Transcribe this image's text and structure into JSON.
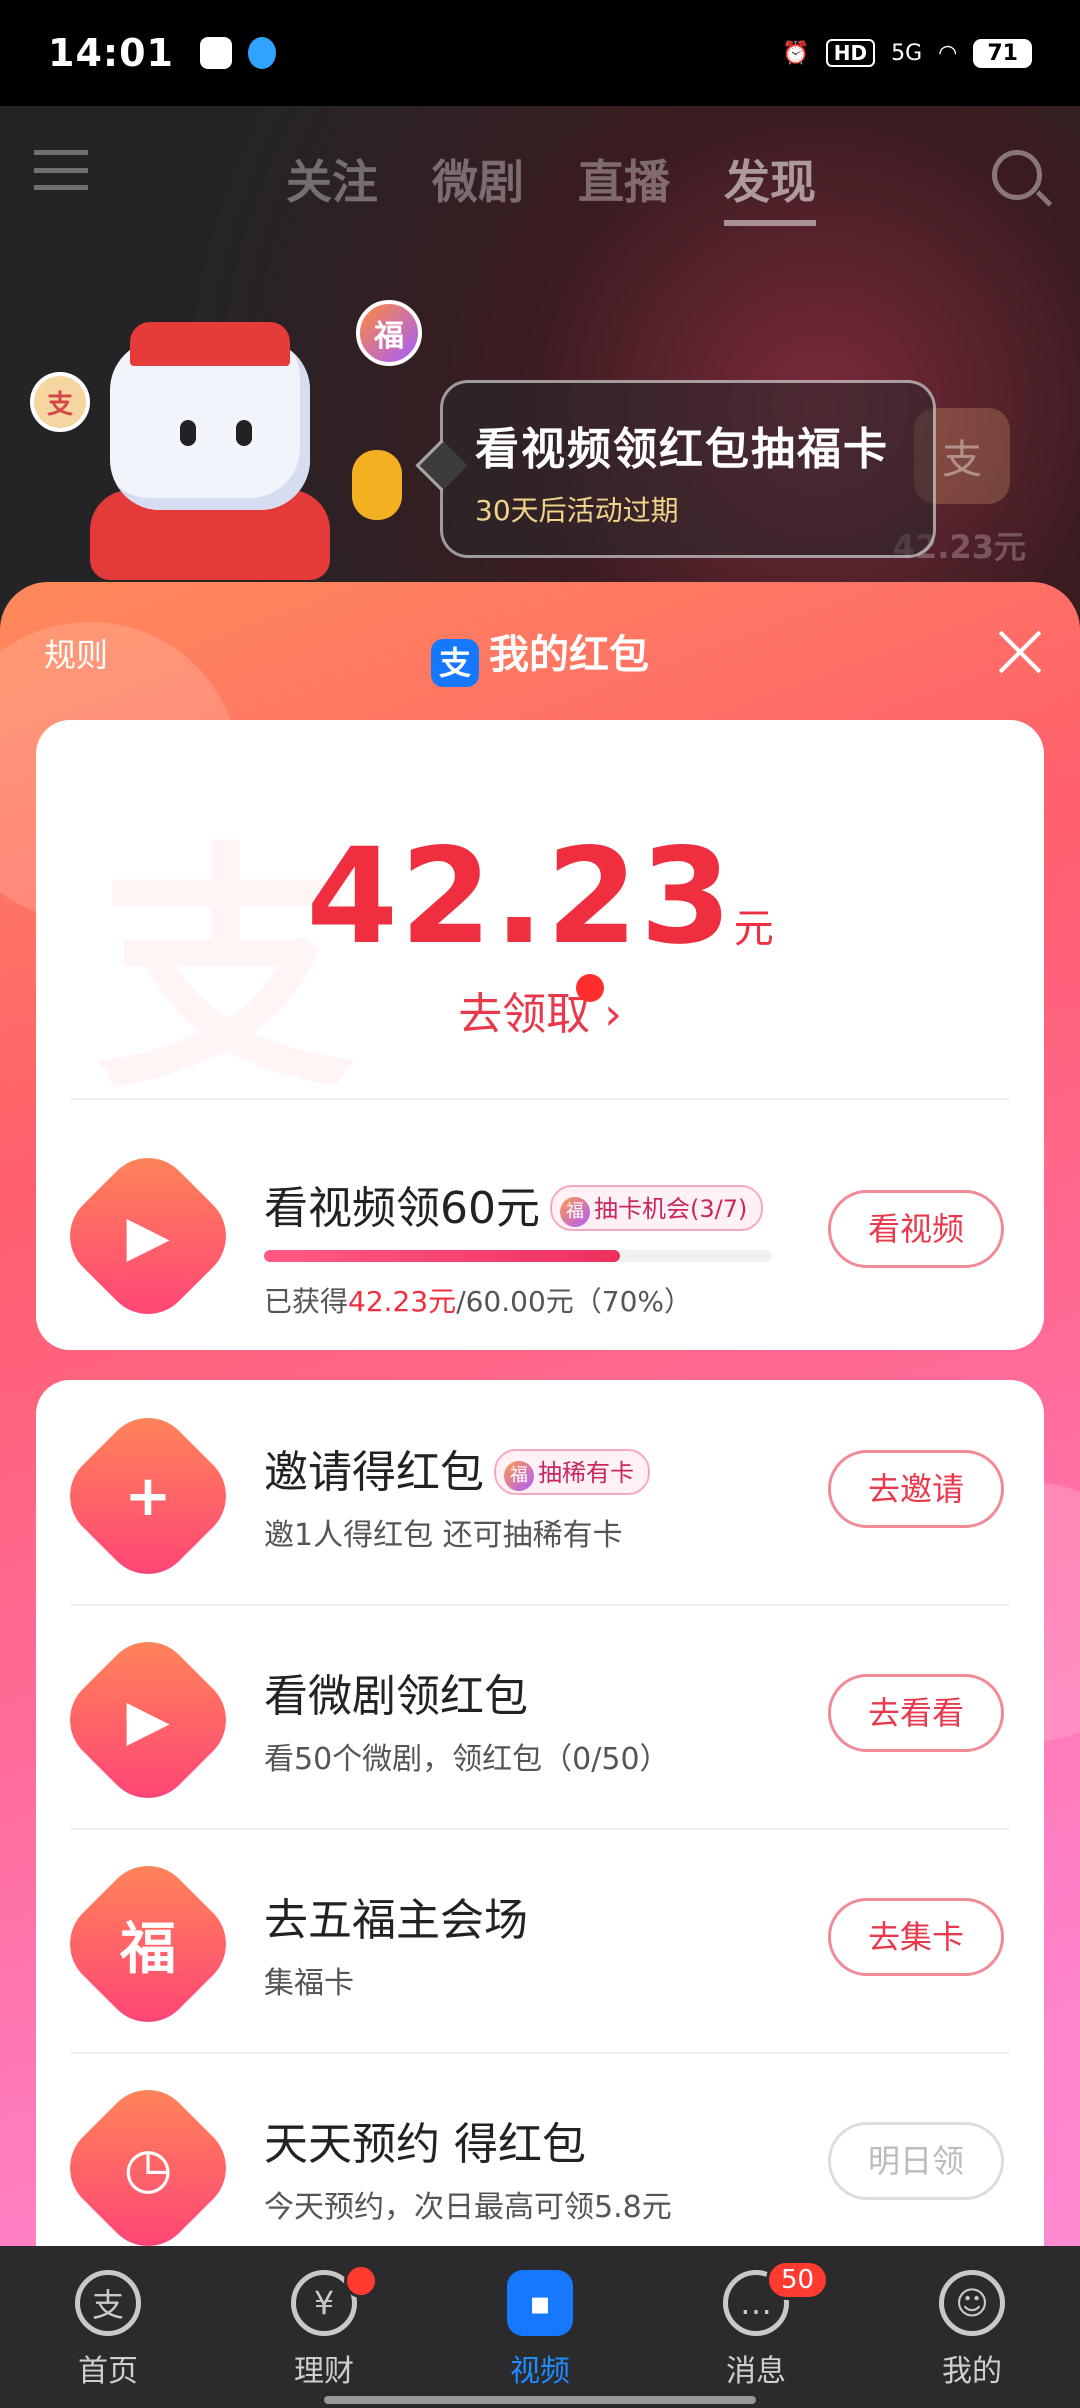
{
  "status_bar": {
    "time": "14:01",
    "hd": "HD",
    "network": "5G",
    "battery": "71"
  },
  "top_nav": {
    "tabs": [
      "关注",
      "微剧",
      "直播",
      "发现"
    ],
    "active_tab": "发现"
  },
  "promo": {
    "title": "看视频领红包抽福卡",
    "subtitle": "30天后活动过期",
    "coin_fu": "福",
    "coin_zhi": "支",
    "bg_amount": "42.23元"
  },
  "sheet": {
    "rules_label": "规则",
    "title": "我的红包",
    "alipay_glyph": "支",
    "balance": {
      "amount": "42.23",
      "unit": "元",
      "claim_label": "去领取 ›"
    },
    "watch_task": {
      "title": "看视频领60元",
      "badge": "抽卡机会(3/7)",
      "button": "看视频",
      "progress_pct": 70,
      "earned": "42.23元",
      "progress_prefix": "已获得",
      "progress_suffix": "/60.00元（70%）"
    },
    "tasks": [
      {
        "title": "邀请得红包",
        "badge": "抽稀有卡",
        "subtitle": "邀1人得红包 还可抽稀有卡",
        "button": "去邀请",
        "icon": "invite-user-icon",
        "glyph": "+",
        "disabled": false
      },
      {
        "title": "看微剧领红包",
        "badge": "",
        "subtitle": "看50个微剧，领红包（0/50）",
        "button": "去看看",
        "icon": "tv-play-icon",
        "glyph": "▶",
        "disabled": false
      },
      {
        "title": "去五福主会场",
        "badge": "",
        "subtitle": "集福卡",
        "button": "去集卡",
        "icon": "fu-character-icon",
        "glyph": "福",
        "disabled": false
      },
      {
        "title": "天天预约 得红包",
        "badge": "",
        "subtitle": "今天预约，次日最高可领5.8元",
        "button": "明日领",
        "icon": "clock-icon",
        "glyph": "◷",
        "disabled": true
      }
    ]
  },
  "tab_bar": {
    "items": [
      {
        "label": "首页",
        "glyph": "支"
      },
      {
        "label": "理财",
        "glyph": "¥"
      },
      {
        "label": "视频",
        "glyph": "▪"
      },
      {
        "label": "消息",
        "glyph": "…",
        "badge": "50"
      },
      {
        "label": "我的",
        "glyph": "☺"
      }
    ]
  },
  "colors": {
    "accent": "#ef2f3f",
    "brand_blue": "#1677ff",
    "sheet_gradient_start": "#ff8a5a",
    "sheet_gradient_end": "#ff8ad0"
  }
}
